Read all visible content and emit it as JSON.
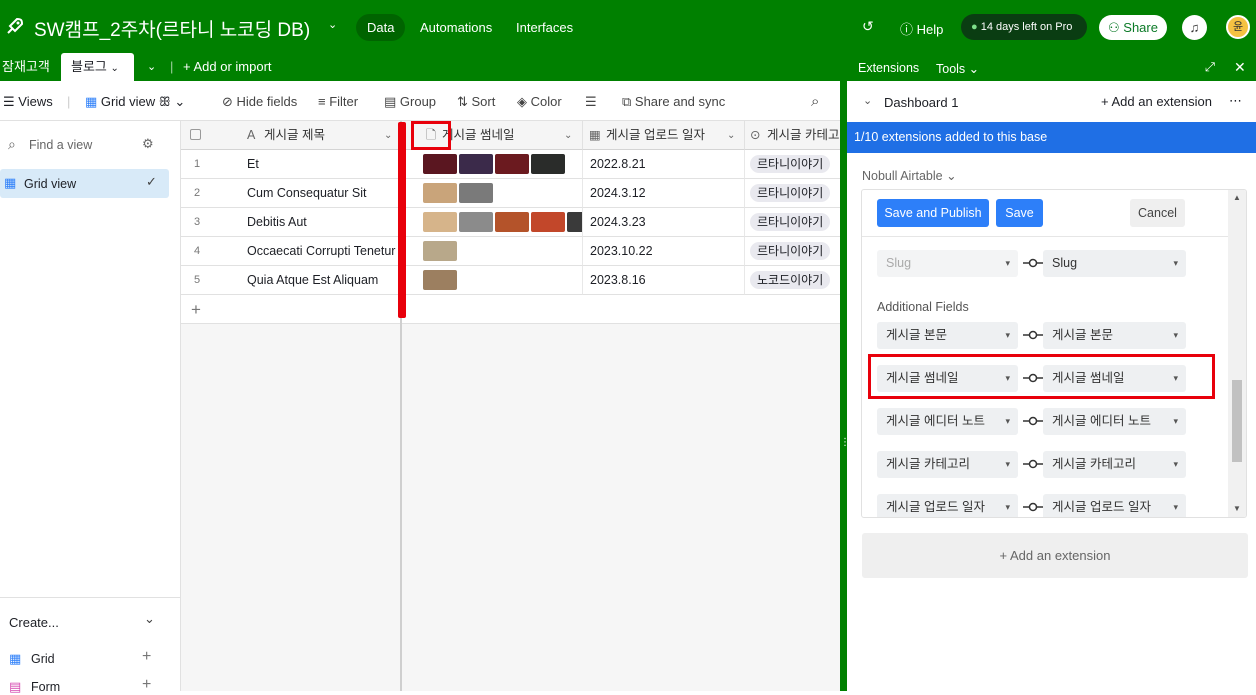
{
  "topbar": {
    "title": "SW캠프_2주차(르타니 노코딩 DB)",
    "nav": [
      "Data",
      "Automations",
      "Interfaces"
    ],
    "help": "Help",
    "pro": "14 days left on Pro",
    "share": "Share",
    "avatar": "윤"
  },
  "tabs": {
    "first": "잠재고객",
    "active": "블로그",
    "add": "Add or import"
  },
  "toolbar": {
    "views": "Views",
    "grid_view": "Grid view",
    "hide": "Hide fields",
    "filter": "Filter",
    "group": "Group",
    "sort": "Sort",
    "color": "Color",
    "share": "Share and sync"
  },
  "sidebar": {
    "find": "Find a view",
    "item": "Grid view",
    "create": "Create...",
    "grid": "Grid",
    "form": "Form"
  },
  "grid": {
    "headers": [
      "게시글 제목",
      "게시글 썸네일",
      "게시글 업로드 일자",
      "게시글 카테고"
    ],
    "rows": [
      {
        "n": "1",
        "title": "Et",
        "date": "2022.8.21",
        "cat": "르타니이야기"
      },
      {
        "n": "2",
        "title": "Cum Consequatur Sit",
        "date": "2024.3.12",
        "cat": "르타니이야기"
      },
      {
        "n": "3",
        "title": "Debitis Aut",
        "date": "2024.3.23",
        "cat": "르타니이야기"
      },
      {
        "n": "4",
        "title": "Occaecati Corrupti Tenetur",
        "date": "2023.10.22",
        "cat": "르타니이야기"
      },
      {
        "n": "5",
        "title": "Quia Atque Est Aliquam",
        "date": "2023.8.16",
        "cat": "노코드이야기"
      }
    ]
  },
  "ext": {
    "extensions": "Extensions",
    "tools": "Tools",
    "dashboard": "Dashboard 1",
    "add_ext": "Add an extension",
    "banner": "1/10 extensions added to this base",
    "app": "Nobull Airtable",
    "save_publish": "Save and Publish",
    "save": "Save",
    "cancel": "Cancel",
    "additional": "Additional Fields",
    "slug_left": "Slug",
    "slug_right": "Slug",
    "fields": [
      [
        "게시글 본문",
        "게시글 본문"
      ],
      [
        "게시글 썸네일",
        "게시글 썸네일"
      ],
      [
        "게시글 에디터 노트",
        "게시글 에디터 노트"
      ],
      [
        "게시글 카테고리",
        "게시글 카테고리"
      ],
      [
        "게시글 업로드 일자",
        "게시글 업로드 일자"
      ]
    ],
    "add_bottom": "Add an extension"
  },
  "colors": {
    "brand": "#008000",
    "blue": "#2d7ff9",
    "banner": "#1f6fe5",
    "highlight": "#e8000b"
  }
}
